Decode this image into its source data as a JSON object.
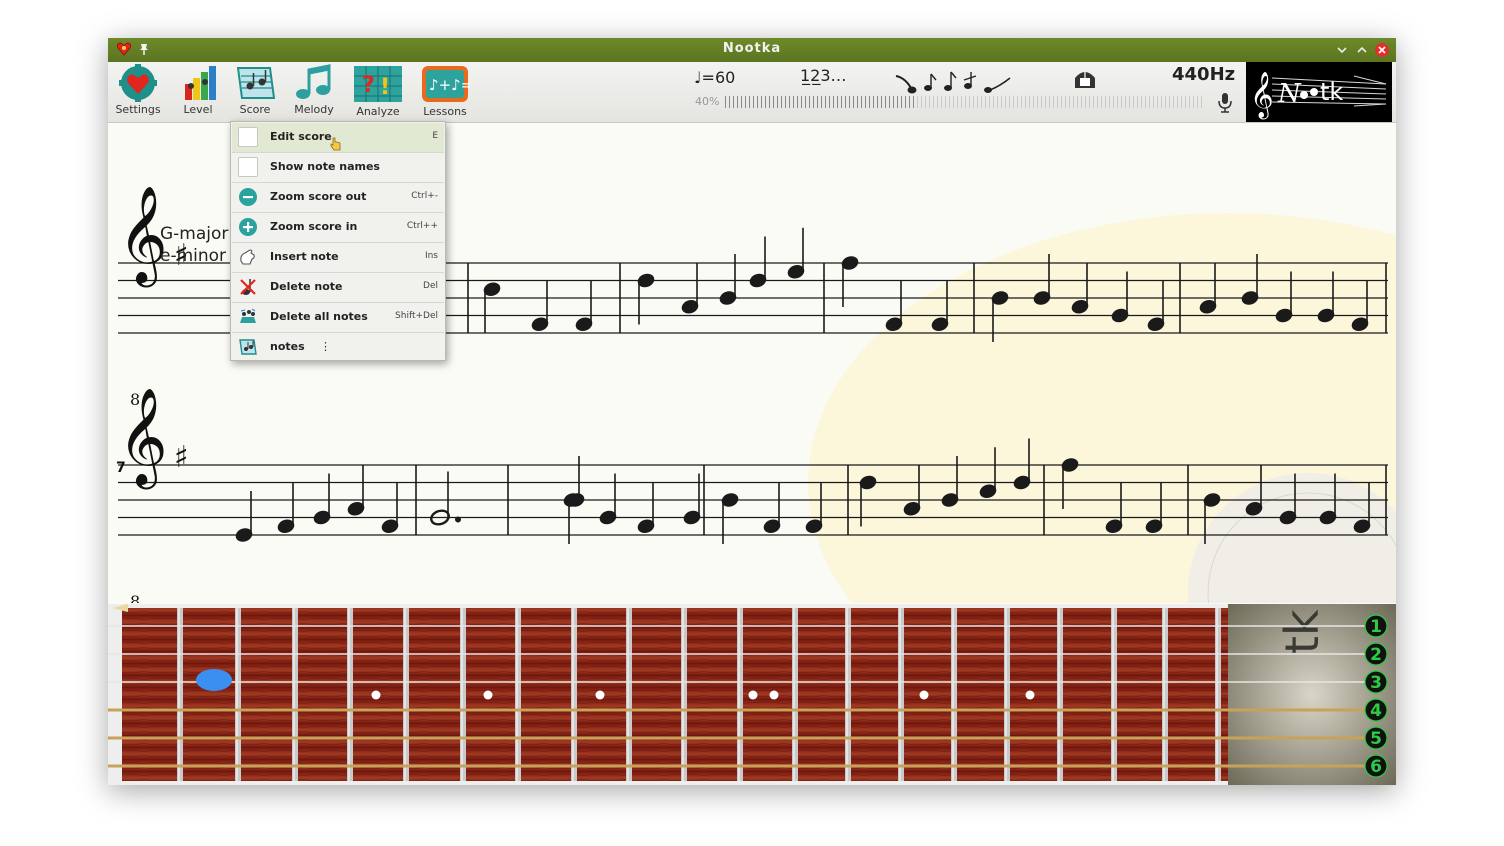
{
  "window": {
    "title": "Nootka"
  },
  "toolbar": {
    "buttons": [
      {
        "label": "Settings",
        "icon": "settings-heart-gear-icon"
      },
      {
        "label": "Level",
        "icon": "level-bars-icon"
      },
      {
        "label": "Score",
        "icon": "score-icon"
      },
      {
        "label": "Melody",
        "icon": "melody-notes-icon"
      },
      {
        "label": "Analyze",
        "icon": "analyze-chart-icon"
      },
      {
        "label": "Lessons",
        "icon": "lessons-icon"
      }
    ],
    "tempo": "♩=60",
    "count_in": "1̲2̲3…",
    "pitch": "440Hz",
    "volume": "40%",
    "volume_level": 0.4,
    "colors": {
      "accent": "#5f7a24",
      "lessons": "#e86a1c"
    }
  },
  "menu": {
    "items": [
      {
        "label": "Edit score",
        "shortcut": "E",
        "icon": "checkbox"
      },
      {
        "label": "Show note names",
        "shortcut": "",
        "icon": "checkbox"
      },
      {
        "label": "Zoom score out",
        "shortcut": "Ctrl+-",
        "icon": "zoom-out-icon"
      },
      {
        "label": "Zoom score in",
        "shortcut": "Ctrl++",
        "icon": "zoom-in-icon"
      },
      {
        "label": "Insert note",
        "shortcut": "Ins",
        "icon": "insert-note-icon"
      },
      {
        "label": "Delete note",
        "shortcut": "Del",
        "icon": "delete-note-icon"
      },
      {
        "label": "Delete all notes",
        "shortcut": "Shift+Del",
        "icon": "delete-all-icon"
      },
      {
        "label": "notes",
        "shortcut": "",
        "icon": "notes-icon",
        "more": "⋮"
      }
    ]
  },
  "score": {
    "key_major": "G-major",
    "key_minor": "e-minor",
    "measure_number": "7",
    "clef_octave": "8"
  },
  "fretboard": {
    "strings": [
      "1",
      "2",
      "3",
      "4",
      "5",
      "6"
    ],
    "selected_position": {
      "string": 3,
      "fret": 1
    }
  }
}
